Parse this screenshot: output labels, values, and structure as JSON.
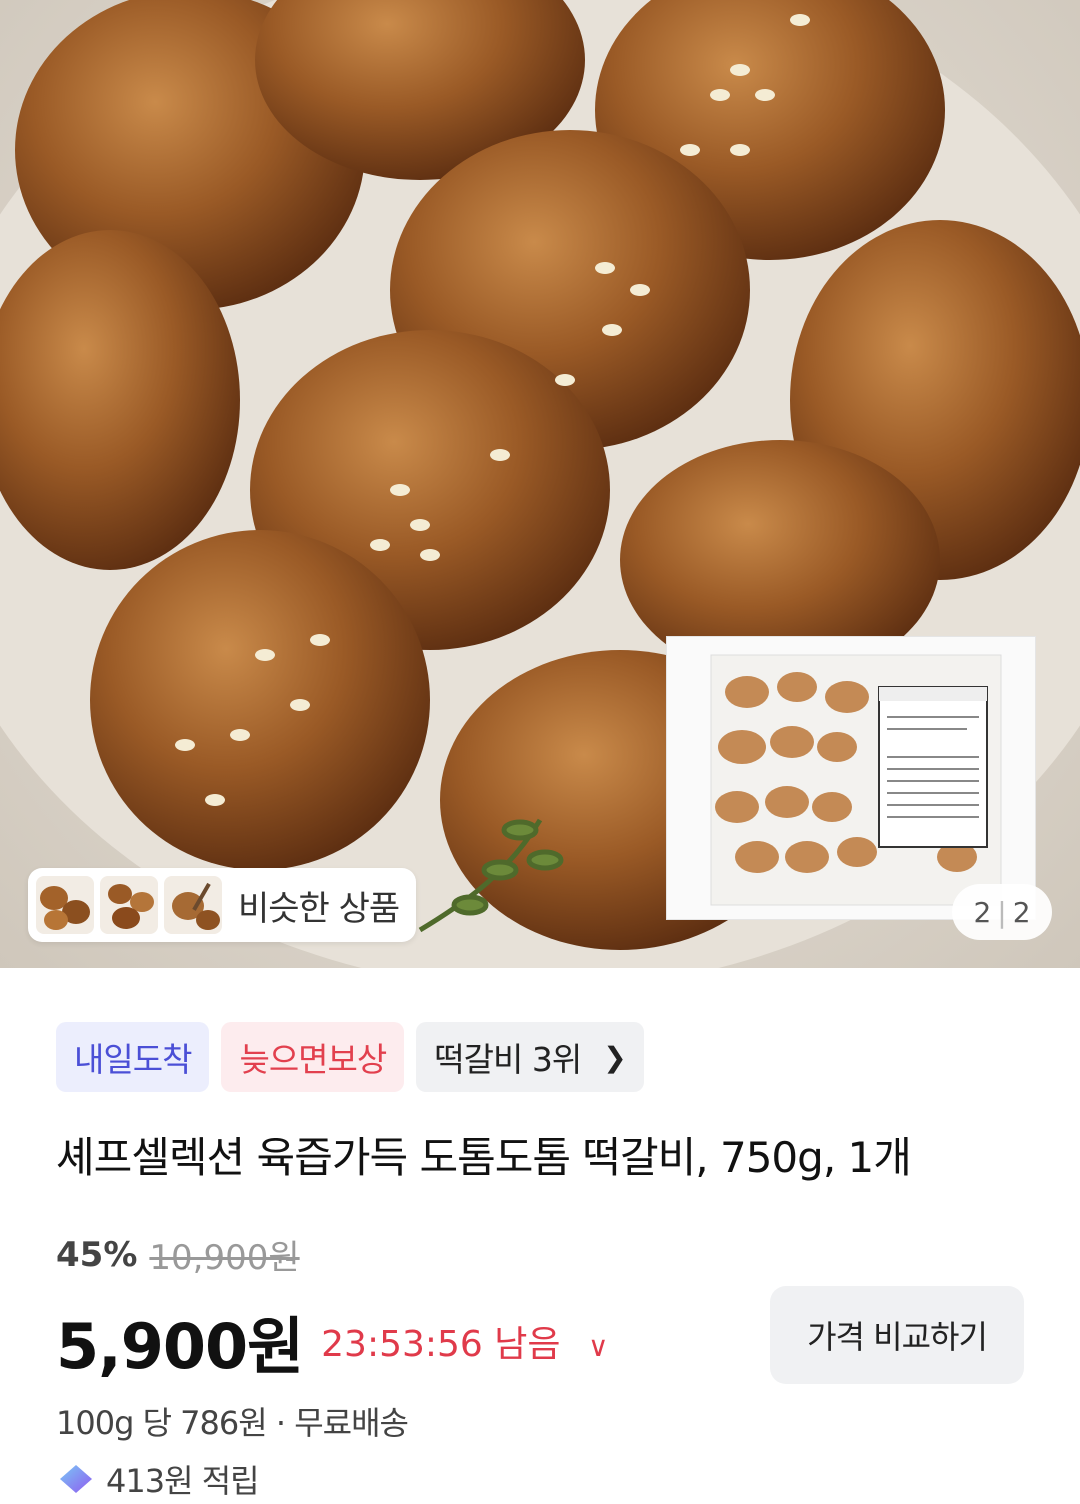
{
  "similar": {
    "label": "비슷한 상품"
  },
  "pager": {
    "current": "2",
    "total": "2"
  },
  "badges": [
    {
      "label": "내일도착"
    },
    {
      "label": "늦으면보상"
    },
    {
      "label": "떡갈비 3위"
    }
  ],
  "product": {
    "title": "셰프셀렉션 육즙가득 도톰도톰 떡갈비, 750g, 1개",
    "discount_percent": "45%",
    "original_price": "10,900원",
    "price": "5,900원",
    "timer": "23:53:56 남음",
    "unit_price": "100g 당 786원",
    "shipping": "무료배송",
    "reward": "413원 적립"
  },
  "compare_button": {
    "label": "가격 비교하기"
  },
  "colors": {
    "accent_red": "#e03a4a",
    "badge_blue": "#4b4fd6",
    "badge_red": "#e2404e"
  }
}
